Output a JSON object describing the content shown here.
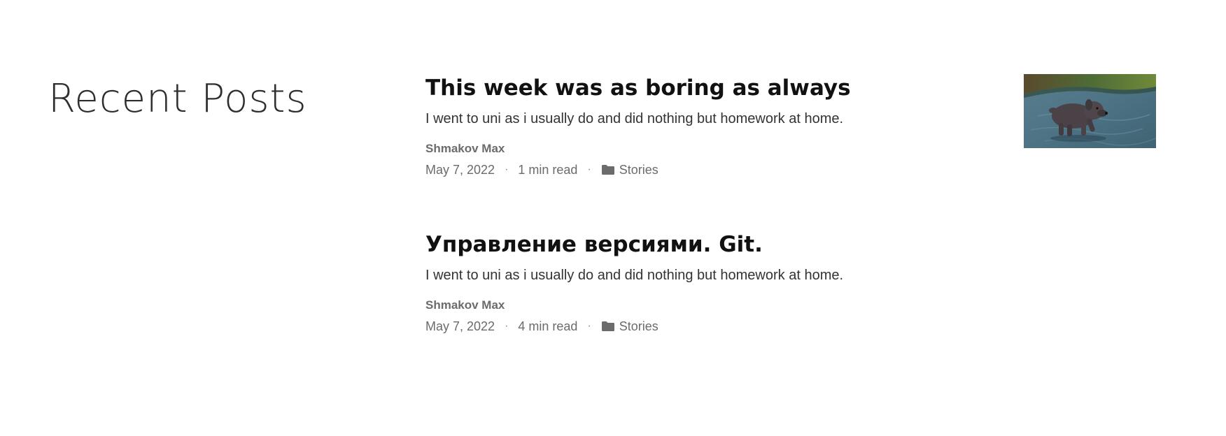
{
  "section": {
    "title": "Recent Posts"
  },
  "posts": [
    {
      "title": "This week was as boring as always",
      "summary": "I went to uni as i usually do and did nothing but homework at home.",
      "author": "Shmakov Max",
      "date": "May 7, 2022",
      "read_time": "1 min read",
      "category": "Stories",
      "has_thumbnail": true
    },
    {
      "title": "Управление версиями. Git.",
      "summary": "I went to uni as i usually do and did nothing but homework at home.",
      "author": "Shmakov Max",
      "date": "May 7, 2022",
      "read_time": "4 min read",
      "category": "Stories",
      "has_thumbnail": false
    }
  ],
  "meta_separator": "·",
  "icons": {
    "category": "folder-icon",
    "thumbnail": "dog-photo"
  },
  "colors": {
    "title": "#111111",
    "meta": "#6b6b6b",
    "heading": "#2e2e2e"
  }
}
